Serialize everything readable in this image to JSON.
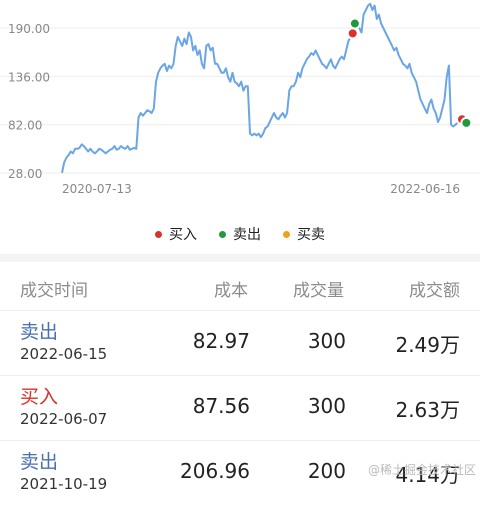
{
  "colors": {
    "line": "#6aa6e6",
    "buy": "#d9312b",
    "sell": "#1f9a3d",
    "both": "#f2a118",
    "sell_text": "#4a6fb3",
    "buy_text": "#d9312b"
  },
  "chart_data": {
    "type": "line",
    "y_ticks": [
      "190.00",
      "136.00",
      "82.00",
      "28.00"
    ],
    "y_tick_values": [
      190,
      136,
      82,
      28
    ],
    "ylim": [
      28,
      217
    ],
    "x_tick_labels": [
      "2020-07-13",
      "2022-06-16"
    ],
    "grid": true,
    "series": [
      {
        "values": [
          28,
          40,
          45,
          48,
          52,
          50,
          55,
          55,
          56,
          60,
          58,
          55,
          52,
          55,
          52,
          50,
          52,
          55,
          54,
          52,
          50,
          52,
          54,
          55,
          58,
          54,
          55,
          58,
          56,
          55,
          58,
          54,
          55,
          56,
          55,
          90,
          95,
          92,
          95,
          98,
          97,
          95,
          100,
          130,
          140,
          145,
          148,
          150,
          142,
          148,
          145,
          150,
          170,
          180,
          175,
          170,
          178,
          172,
          185,
          180,
          165,
          170,
          160,
          165,
          150,
          145,
          170,
          172,
          165,
          168,
          150,
          150,
          145,
          140,
          140,
          145,
          135,
          130,
          140,
          130,
          128,
          125,
          130,
          120,
          125,
          125,
          72,
          70,
          72,
          70,
          72,
          68,
          72,
          78,
          80,
          85,
          90,
          95,
          90,
          88,
          92,
          95,
          90,
          95,
          120,
          125,
          125,
          130,
          140,
          135,
          145,
          150,
          155,
          158,
          162,
          160,
          165,
          160,
          155,
          150,
          148,
          145,
          150,
          155,
          148,
          145,
          150,
          155,
          158,
          155,
          165,
          175,
          180,
          185,
          195,
          200,
          190,
          185,
          205,
          210,
          215,
          217,
          210,
          215,
          200,
          205,
          195,
          190,
          185,
          180,
          175,
          170,
          165,
          168,
          160,
          155,
          150,
          148,
          145,
          150,
          140,
          135,
          130,
          120,
          110,
          105,
          100,
          95,
          105,
          110,
          100,
          95,
          85,
          90,
          100,
          110,
          135,
          148,
          82,
          80,
          82,
          84,
          85,
          83
        ]
      }
    ],
    "markers": [
      {
        "kind": "buy",
        "index": 133,
        "value": 184
      },
      {
        "kind": "sell",
        "index": 134,
        "value": 195
      },
      {
        "kind": "buy",
        "index": 183,
        "value": 88
      },
      {
        "kind": "sell",
        "index": 185,
        "value": 84
      }
    ]
  },
  "legend": {
    "buy_label": "买入",
    "sell_label": "卖出",
    "both_label": "买卖"
  },
  "table": {
    "headers": {
      "time": "成交时间",
      "cost": "成本",
      "volume": "成交量",
      "amount": "成交额"
    },
    "rows": [
      {
        "type": "卖出",
        "kind": "sell",
        "date": "2022-06-15",
        "cost": "82.97",
        "volume": "300",
        "amount": "2.49万"
      },
      {
        "type": "买入",
        "kind": "buy",
        "date": "2022-06-07",
        "cost": "87.56",
        "volume": "300",
        "amount": "2.63万"
      },
      {
        "type": "卖出",
        "kind": "sell",
        "date": "2021-10-19",
        "cost": "206.96",
        "volume": "200",
        "amount": "4.14万"
      }
    ]
  },
  "watermark": "@稀土掘金技术社区"
}
